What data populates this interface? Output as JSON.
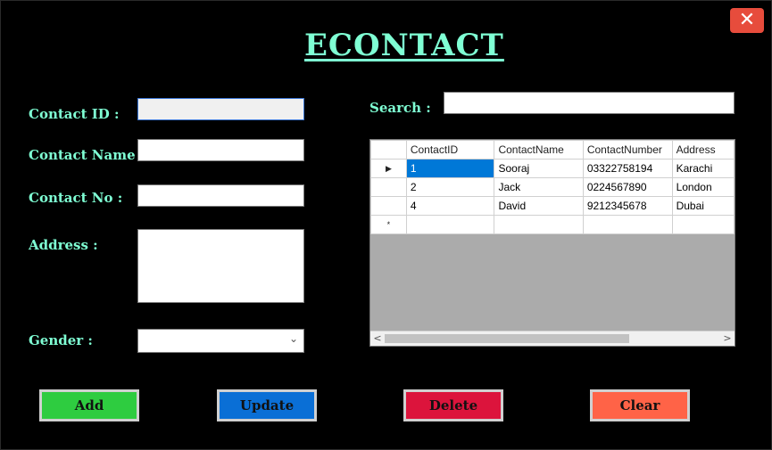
{
  "window": {
    "title": "ECONTACT",
    "close_label": "✕"
  },
  "form": {
    "contact_id_label": "Contact ID :",
    "contact_name_label": "Contact Name :",
    "contact_no_label": "Contact No :",
    "address_label": "Address  :",
    "gender_label": "Gender  :",
    "contact_id_value": "",
    "contact_name_value": "",
    "contact_no_value": "",
    "address_value": "",
    "gender_value": ""
  },
  "search": {
    "label": "Search :",
    "value": ""
  },
  "grid": {
    "columns": [
      "ContactID",
      "ContactName",
      "ContactNumber",
      "Address"
    ],
    "rows": [
      [
        "1",
        "Sooraj",
        "03322758194",
        "Karachi"
      ],
      [
        "2",
        "Jack",
        "0224567890",
        "London"
      ],
      [
        "4",
        "David",
        "9212345678",
        "Dubai"
      ]
    ],
    "current_row_marker": "▶",
    "new_row_marker": "*"
  },
  "buttons": {
    "add": "Add",
    "update": "Update",
    "delete": "Delete",
    "clear": "Clear"
  },
  "colors": {
    "accent_text": "#7fffd4",
    "add": "#2ecc40",
    "update": "#0a6fd6",
    "delete": "#dc143c",
    "clear": "#ff6347",
    "close": "#e74c3c"
  }
}
